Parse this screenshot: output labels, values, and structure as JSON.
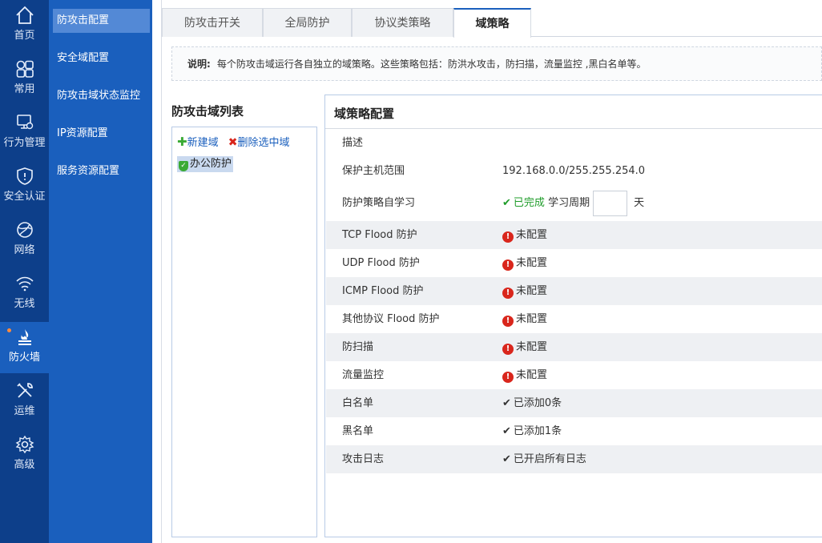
{
  "nav_main": [
    {
      "label": "首页",
      "icon": "home-icon"
    },
    {
      "label": "常用",
      "icon": "apps-icon"
    },
    {
      "label": "行为管理",
      "icon": "behavior-monitor-icon"
    },
    {
      "label": "安全认证",
      "icon": "shield-alert-icon"
    },
    {
      "label": "网络",
      "icon": "globe-icon"
    },
    {
      "label": "无线",
      "icon": "wifi-icon"
    },
    {
      "label": "防火墙",
      "icon": "firewall-icon"
    },
    {
      "label": "运维",
      "icon": "tools-icon"
    },
    {
      "label": "高级",
      "icon": "gear-icon"
    }
  ],
  "nav_sub": [
    {
      "label": "防攻击配置"
    },
    {
      "label": "安全域配置"
    },
    {
      "label": "防攻击域状态监控"
    },
    {
      "label": "IP资源配置"
    },
    {
      "label": "服务资源配置"
    }
  ],
  "tabs": [
    {
      "label": "防攻击开关"
    },
    {
      "label": "全局防护"
    },
    {
      "label": "协议类策略"
    },
    {
      "label": "域策略"
    }
  ],
  "note": {
    "label": "说明:",
    "text": "每个防攻击域运行各自独立的域策略。这些策略包括：防洪水攻击，防扫描，流量监控 ,黑白名单等。"
  },
  "domain_list": {
    "title": "防攻击域列表",
    "new_label": "新建域",
    "delete_label": "删除选中域",
    "items": [
      {
        "label": "办公防护"
      }
    ]
  },
  "policy": {
    "title": "域策略配置",
    "desc_label": "描述",
    "host_range_label": "保护主机范围",
    "host_range_value": "192.168.0.0/255.255.254.0",
    "self_learn_label": "防护策略自学习",
    "self_learn_status": "已完成",
    "period_label": "学习周期",
    "period_value": "",
    "period_unit": "天",
    "rows": [
      {
        "label": "TCP Flood 防护",
        "status": "未配置"
      },
      {
        "label": "UDP Flood 防护",
        "status": "未配置"
      },
      {
        "label": "ICMP Flood 防护",
        "status": "未配置"
      },
      {
        "label": "其他协议 Flood 防护",
        "status": "未配置"
      },
      {
        "label": "防扫描",
        "status": "未配置"
      },
      {
        "label": "流量监控",
        "status": "未配置"
      },
      {
        "label": "白名单",
        "status": "已添加0条"
      },
      {
        "label": "黑名单",
        "status": "已添加1条"
      },
      {
        "label": "攻击日志",
        "status": "已开启所有日志"
      }
    ]
  },
  "colors": {
    "nav_main_bg": "#0d3f8a",
    "nav_sub_bg": "#1a5fbd",
    "ok": "#1f9c2a",
    "warn": "#e46a12",
    "error_icon": "#d9261c"
  }
}
